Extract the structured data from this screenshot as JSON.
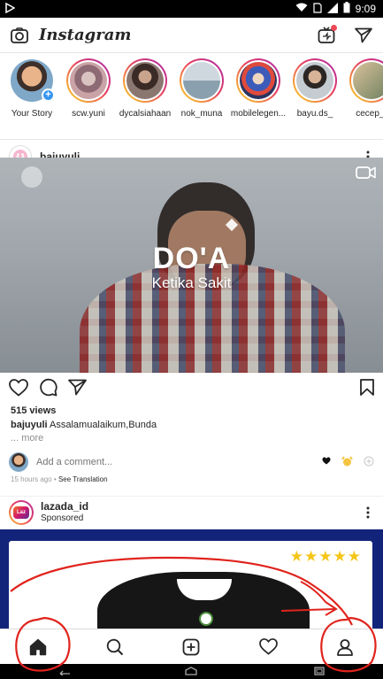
{
  "status_bar": {
    "time": "9:09"
  },
  "app": {
    "title": "Instagram"
  },
  "stories": [
    {
      "name": "Your Story",
      "color": "#e9b48a",
      "own": true
    },
    {
      "name": "scw.yuni",
      "color": "#c7a6a8"
    },
    {
      "name": "dycalsiahaan",
      "color": "#7d6560"
    },
    {
      "name": "nok_muna",
      "color": "#a7b8c6"
    },
    {
      "name": "mobilelegen...",
      "color": "#5a72b8"
    },
    {
      "name": "bayu.ds_",
      "color": "#8ca0b2"
    },
    {
      "name": "cecep_r",
      "color": "#b89a70"
    }
  ],
  "post": {
    "username": "bajuyuli",
    "overlay_title": "DO'A",
    "overlay_subtitle": "Ketika Sakit",
    "views": "515 views",
    "caption_user": "bajuyuli",
    "caption_text": "Assalamualaikum,Bunda",
    "more": "... more",
    "comment_placeholder": "Add a comment...",
    "time_ago": "15 hours ago",
    "see_translation": "See Translation"
  },
  "ad": {
    "username": "lazada_id",
    "label": "Sponsored",
    "logo_text": "Laz",
    "rating_stars": 5
  },
  "colors": {
    "accent_blue": "#3897f0",
    "annotation_red": "#e0231c",
    "ad_background": "#12247a"
  }
}
